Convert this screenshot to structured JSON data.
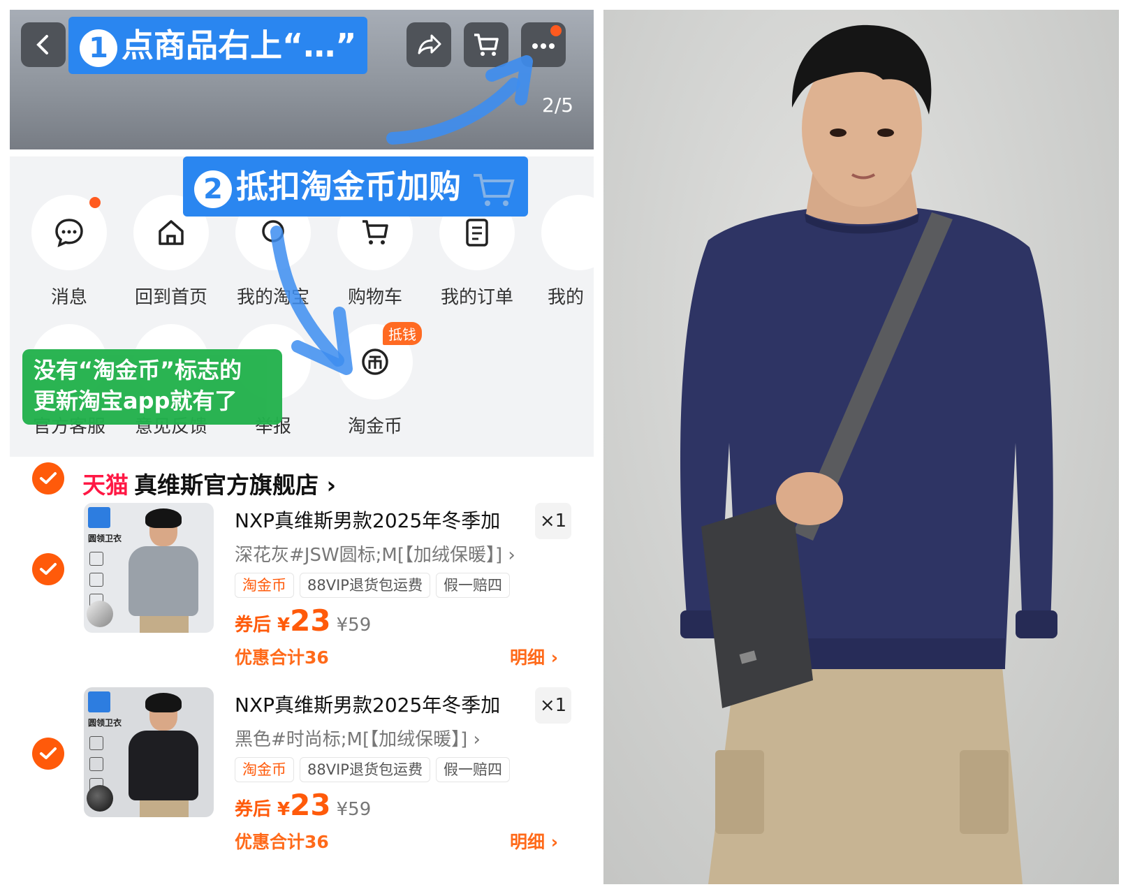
{
  "topbar": {
    "callout_1_num": "1",
    "callout_1_text": "点商品右上“…”",
    "page_indicator": "2/5",
    "icons": [
      "back-icon",
      "share-icon",
      "cart-icon",
      "more-icon"
    ]
  },
  "callout_2": {
    "num": "2",
    "text": "抵扣淘金币加购"
  },
  "menu": {
    "row1": [
      "消息",
      "回到首页",
      "我的淘宝",
      "购物车",
      "我的订单",
      "我的"
    ],
    "row2": [
      "官方客服",
      "意见反馈",
      "举报",
      "淘金币"
    ],
    "badge": "抵钱"
  },
  "green_callout": {
    "line1": "没有“淘金币”标志的",
    "line2": "更新淘宝app就有了"
  },
  "store": {
    "tmall": "天猫",
    "name": "真维斯官方旗舰店",
    "chevron": "›"
  },
  "items": [
    {
      "title": "NXP真维斯男款2025年冬季加",
      "qty": "×1",
      "spec": "深花灰#JSW圆标;M[【加绒保暖】] ›",
      "tags": [
        "淘金币",
        "88VIP退货包运费",
        "假一赔四"
      ],
      "price_prefix": "券后 ¥",
      "price": "23",
      "orig_price": "¥59",
      "saving": "优惠合计36",
      "detail": "明细 ›",
      "thumb_title": "圆领卫衣",
      "shirt_color": "#9aa1a9"
    },
    {
      "title": "NXP真维斯男款2025年冬季加",
      "qty": "×1",
      "spec": "黑色#时尚标;M[【加绒保暖】] ›",
      "tags": [
        "淘金币",
        "88VIP退货包运费",
        "假一赔四"
      ],
      "price_prefix": "券后 ¥",
      "price": "23",
      "orig_price": "¥59",
      "saving": "优惠合计36",
      "detail": "明细 ›",
      "thumb_title": "圆领卫衣",
      "shirt_color": "#1e1e22"
    }
  ],
  "colors": {
    "accent_orange": "#ff5a0a",
    "callout_blue": "#2a86f0",
    "callout_green": "#22b14c",
    "tmall_red": "#ff1844",
    "sweatshirt_navy": "#2e3464"
  }
}
